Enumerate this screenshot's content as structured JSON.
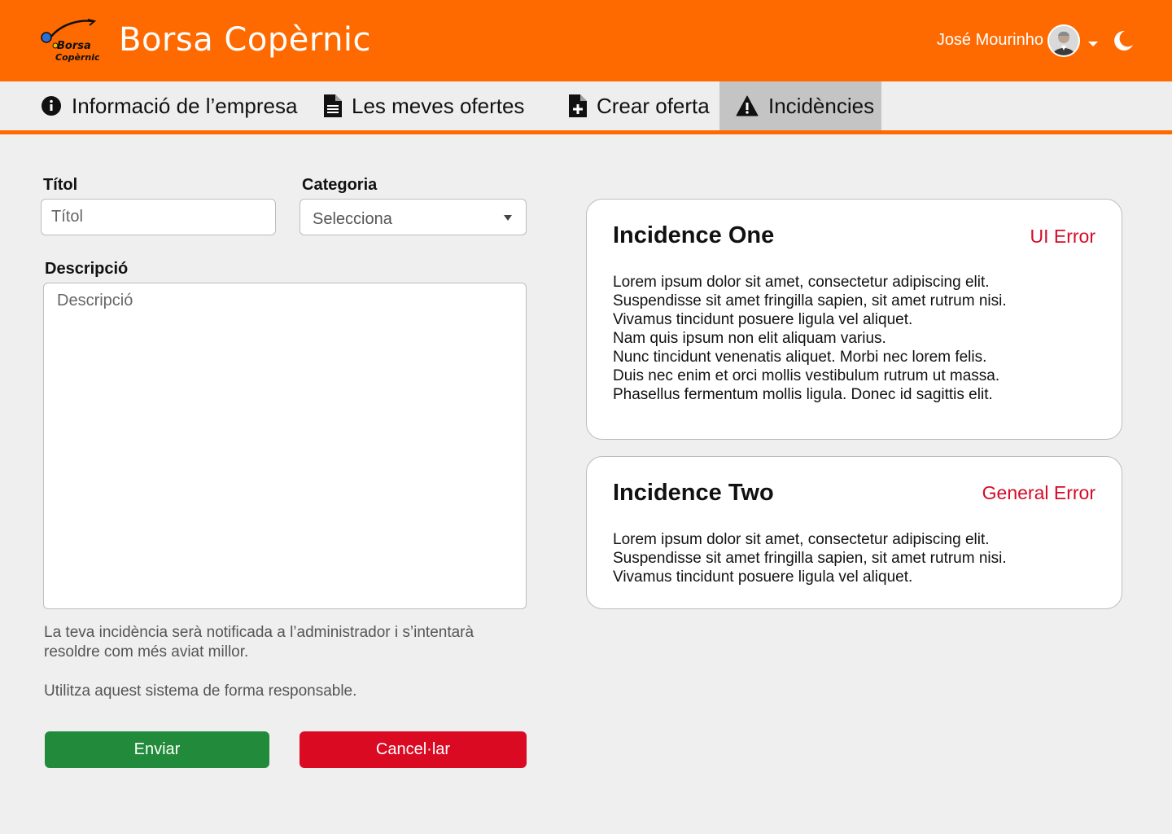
{
  "header": {
    "title": "Borsa Copèrnic",
    "logo_text": [
      "Borsa",
      "Copèrnic"
    ],
    "user_name": "José Mourinho"
  },
  "tabs": [
    {
      "label": "Informació de l’empresa",
      "icon": "info-circle-icon"
    },
    {
      "label": "Les meves ofertes",
      "icon": "file-icon"
    },
    {
      "label": "Crear oferta",
      "icon": "file-plus-icon"
    },
    {
      "label": "Incidències",
      "icon": "warning-icon",
      "active": true
    }
  ],
  "form": {
    "title_label": "Títol",
    "title_placeholder": "Títol",
    "category_label": "Categoria",
    "category_value": "Selecciona",
    "description_label": "Descripció",
    "description_placeholder": "Descripció",
    "note_1": "La teva incidència serà notificada a l’administrador i s’intentarà resoldre com més aviat millor.",
    "note_2": "Utilitza aquest sistema de forma responsable.",
    "send_label": "Enviar",
    "cancel_label": "Cancel·lar"
  },
  "incidences": [
    {
      "title": "Incidence One",
      "category": "UI Error",
      "lines": [
        "Lorem ipsum dolor sit amet, consectetur adipiscing elit.",
        "Suspendisse sit amet fringilla sapien, sit amet rutrum nisi.",
        "Vivamus tincidunt posuere ligula vel aliquet.",
        "Nam quis ipsum non elit aliquam varius.",
        "Nunc tincidunt venenatis aliquet. Morbi nec lorem felis.",
        "Duis nec enim et orci mollis vestibulum rutrum ut massa.",
        "Phasellus fermentum mollis ligula. Donec id sagittis elit."
      ]
    },
    {
      "title": "Incidence Two",
      "category": "General Error",
      "lines": [
        "Lorem ipsum dolor sit amet, consectetur adipiscing elit.",
        "Suspendisse sit amet fringilla sapien, sit amet rutrum nisi.",
        "Vivamus tincidunt posuere ligula vel aliquet."
      ]
    }
  ],
  "colors": {
    "brand": "#ff6a00",
    "send": "#218a3b",
    "cancel": "#da0a23",
    "category": "#d40b27"
  }
}
